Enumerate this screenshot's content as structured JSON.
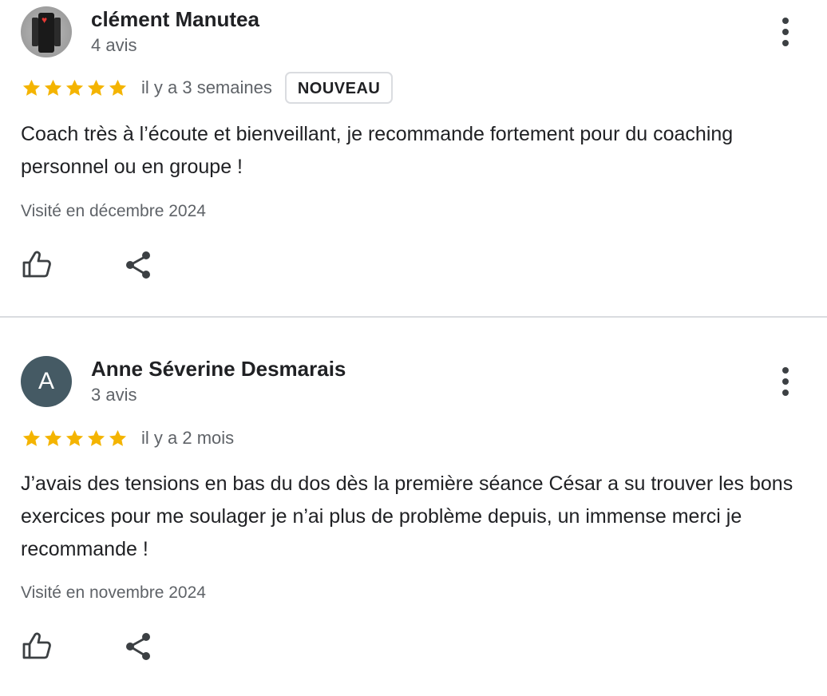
{
  "reviews": [
    {
      "author": "clément Manutea",
      "meta": "4 avis",
      "avatar_icon": "profile-photo-traffic-light-heart",
      "rating": 5,
      "max_rating": 5,
      "time_ago": "il y a 3 semaines",
      "badge": "NOUVEAU",
      "text": "Coach très à l’écoute et bienveillant, je recommande fortement pour du coaching personnel ou en groupe !",
      "visit": "Visité en décembre 2024",
      "actions": [
        "thumbs-up-icon",
        "share-icon"
      ]
    },
    {
      "author": "Anne Séverine Desmarais",
      "meta": "3 avis",
      "avatar_letter": "A",
      "rating": 5,
      "max_rating": 5,
      "time_ago": "il y a 2 mois",
      "text": "J’avais des tensions en bas du dos dès la première séance César a su trouver les bons exercices pour me soulager je n’ai plus de problème depuis, un immense merci je recommande !",
      "visit": "Visité en novembre 2024",
      "actions": [
        "thumbs-up-icon",
        "share-icon"
      ]
    }
  ],
  "colors": {
    "star": "#f4b400",
    "text_primary": "#202124",
    "text_secondary": "#5f6368",
    "divider": "#dadce0",
    "avatar_letter_bg": "#455a64",
    "icon": "#3c4043"
  }
}
